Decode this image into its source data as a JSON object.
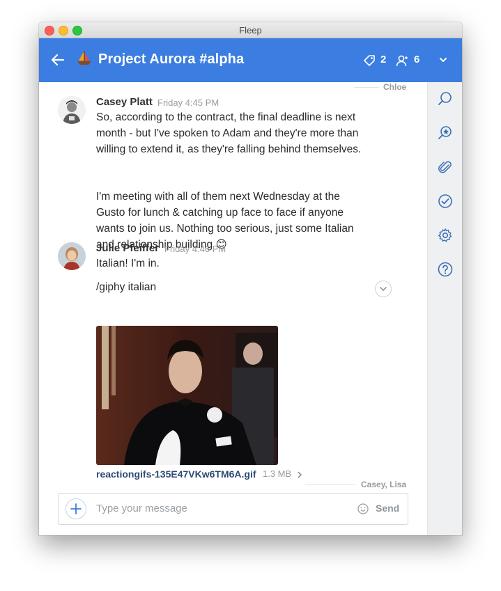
{
  "window": {
    "title": "Fleep"
  },
  "header": {
    "back_icon": "arrow-left-icon",
    "conversation_icon": "sailboat-emoji",
    "title": "Project Aurora #alpha",
    "tags_count": "2",
    "members_count": "6",
    "accent": "#3b7de0"
  },
  "rail": {
    "items": [
      "search-icon",
      "pinned-search-icon",
      "attachment-icon",
      "tasks-check-icon",
      "settings-gear-icon",
      "help-icon"
    ]
  },
  "messages": [
    {
      "author": "Casey Platt",
      "time": "Friday 4:45 PM",
      "paragraphs": [
        [
          "So, according to the contract, the final deadline is next",
          "month - but I've spoken to Adam and they're more than",
          "willing to extend it, as they're falling behind themselves."
        ],
        [
          "I'm meeting with all of them next Wednesday at the",
          "Gusto for lunch & catching up face to face if anyone",
          "wants to join us. Nothing too serious, just some Italian",
          "and relationship building"
        ]
      ],
      "emoji": "😊"
    },
    {
      "author": "Julie Pfeiffer",
      "time": "Friday 4:46 PM",
      "lines": [
        "Italian! I'm in.",
        "/giphy italian"
      ],
      "attachment": {
        "filename": "reactiongifs-135E47VKw6TM6A.gif",
        "size": "1.3 MB"
      }
    }
  ],
  "read_markers": {
    "top": "Chloe",
    "bottom": "Casey, Lisa"
  },
  "composer": {
    "placeholder": "Type your message",
    "send_label": "Send"
  }
}
